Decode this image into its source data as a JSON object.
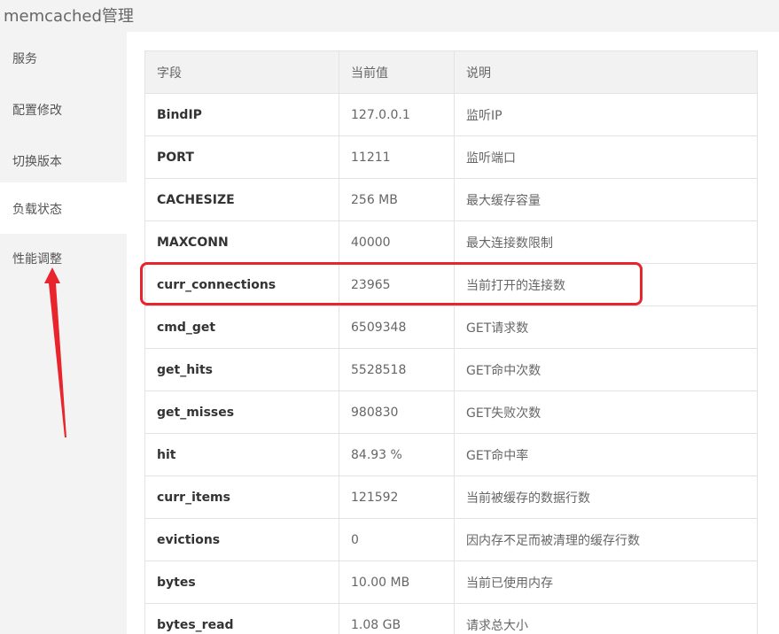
{
  "app": {
    "title": "memcached管理"
  },
  "sidebar": {
    "items": [
      {
        "label": "服务",
        "active": false
      },
      {
        "label": "配置修改",
        "active": false
      },
      {
        "label": "切换版本",
        "active": false
      },
      {
        "label": "负载状态",
        "active": true
      },
      {
        "label": "性能调整",
        "active": false
      }
    ]
  },
  "table": {
    "headers": [
      "字段",
      "当前值",
      "说明"
    ],
    "rows": [
      {
        "field": "BindIP",
        "value": "127.0.0.1",
        "desc": "监听IP"
      },
      {
        "field": "PORT",
        "value": "11211",
        "desc": "监听端口"
      },
      {
        "field": "CACHESIZE",
        "value": "256 MB",
        "desc": "最大缓存容量"
      },
      {
        "field": "MAXCONN",
        "value": "40000",
        "desc": "最大连接数限制"
      },
      {
        "field": "curr_connections",
        "value": "23965",
        "desc": "当前打开的连接数"
      },
      {
        "field": "cmd_get",
        "value": "6509348",
        "desc": "GET请求数"
      },
      {
        "field": "get_hits",
        "value": "5528518",
        "desc": "GET命中次数"
      },
      {
        "field": "get_misses",
        "value": "980830",
        "desc": "GET失败次数"
      },
      {
        "field": "hit",
        "value": "84.93 %",
        "desc": "GET命中率"
      },
      {
        "field": "curr_items",
        "value": "121592",
        "desc": "当前被缓存的数据行数"
      },
      {
        "field": "evictions",
        "value": "0",
        "desc": "因内存不足而被清理的缓存行数"
      },
      {
        "field": "bytes",
        "value": "10.00 MB",
        "desc": "当前已使用内存"
      },
      {
        "field": "bytes_read",
        "value": "1.08 GB",
        "desc": "请求总大小"
      }
    ]
  },
  "annotations": {
    "highlight_color": "#e8242c",
    "arrow_color": "#e8242c"
  }
}
